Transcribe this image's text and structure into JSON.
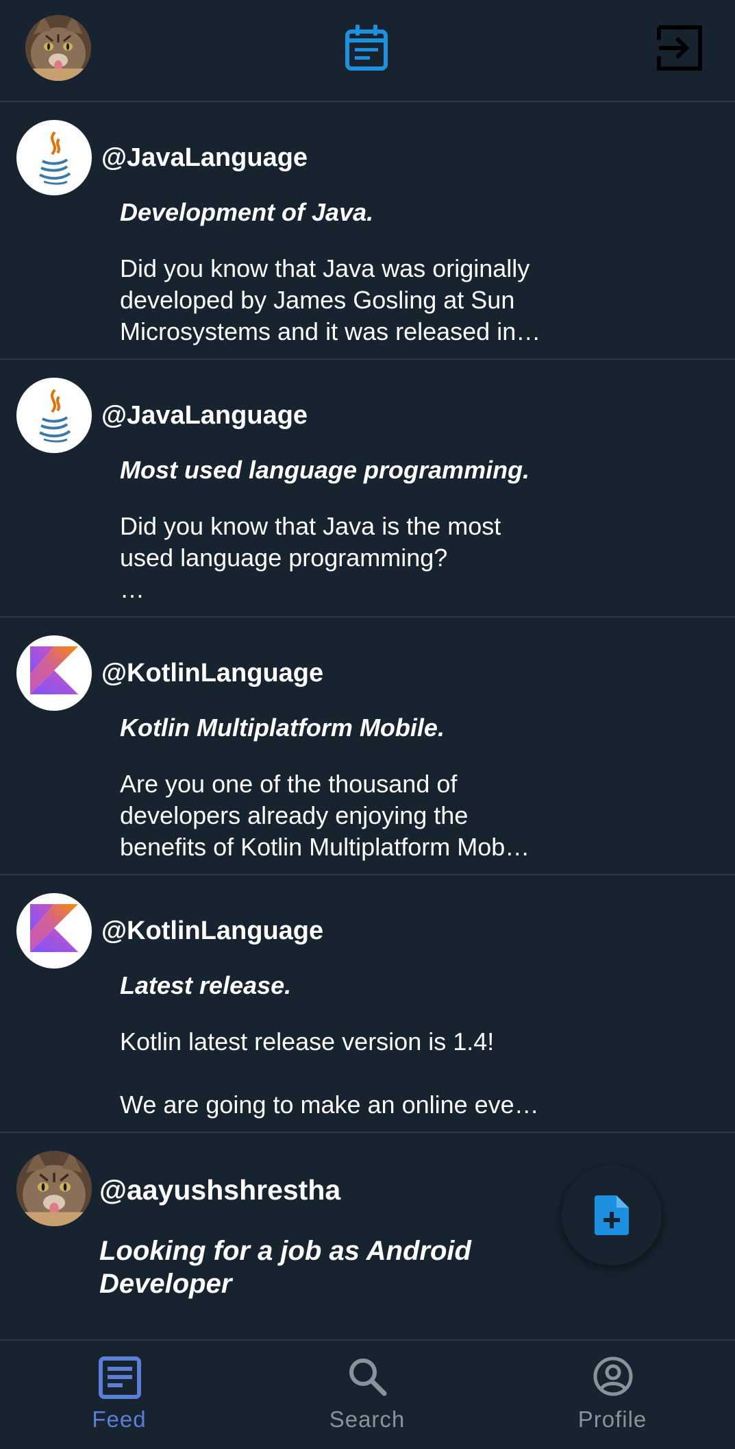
{
  "header": {
    "profile_avatar": "cat-avatar",
    "center_icon": "calendar-icon",
    "right_icon": "logout-icon"
  },
  "posts": [
    {
      "handle": "@JavaLanguage",
      "avatar": "java-logo",
      "title": "Development of Java.",
      "body": "Did you know that Java was originally\ndeveloped by James Gosling at Sun\nMicrosystems and it was released in…"
    },
    {
      "handle": "@JavaLanguage",
      "avatar": "java-logo",
      "title": "Most used language programming.",
      "body": "Did you know that Java is the most\nused language programming?\n…"
    },
    {
      "handle": "@KotlinLanguage",
      "avatar": "kotlin-logo",
      "title": "Kotlin Multiplatform Mobile.",
      "body": "Are you one of the thousand of\ndevelopers already enjoying the\nbenefits of Kotlin Multiplatform Mob…"
    },
    {
      "handle": "@KotlinLanguage",
      "avatar": "kotlin-logo",
      "title": "Latest release.",
      "body": "Kotlin latest release version is 1.4!\n\nWe are going to make an online eve…"
    },
    {
      "handle": "@aayushshrestha",
      "avatar": "cat-avatar",
      "title": "Looking for a job as Android Developer",
      "body": ""
    }
  ],
  "fab": {
    "icon": "add-post-icon"
  },
  "nav": {
    "items": [
      {
        "label": "Feed",
        "icon": "feed-icon",
        "active": true
      },
      {
        "label": "Search",
        "icon": "search-icon",
        "active": false
      },
      {
        "label": "Profile",
        "icon": "profile-icon",
        "active": false
      }
    ]
  },
  "colors": {
    "background": "#17232f",
    "divider": "#2b3945",
    "accent": "#1e90e0",
    "nav_active": "#5b7fd6",
    "nav_inactive": "#8a939b",
    "text": "#ffffff"
  }
}
